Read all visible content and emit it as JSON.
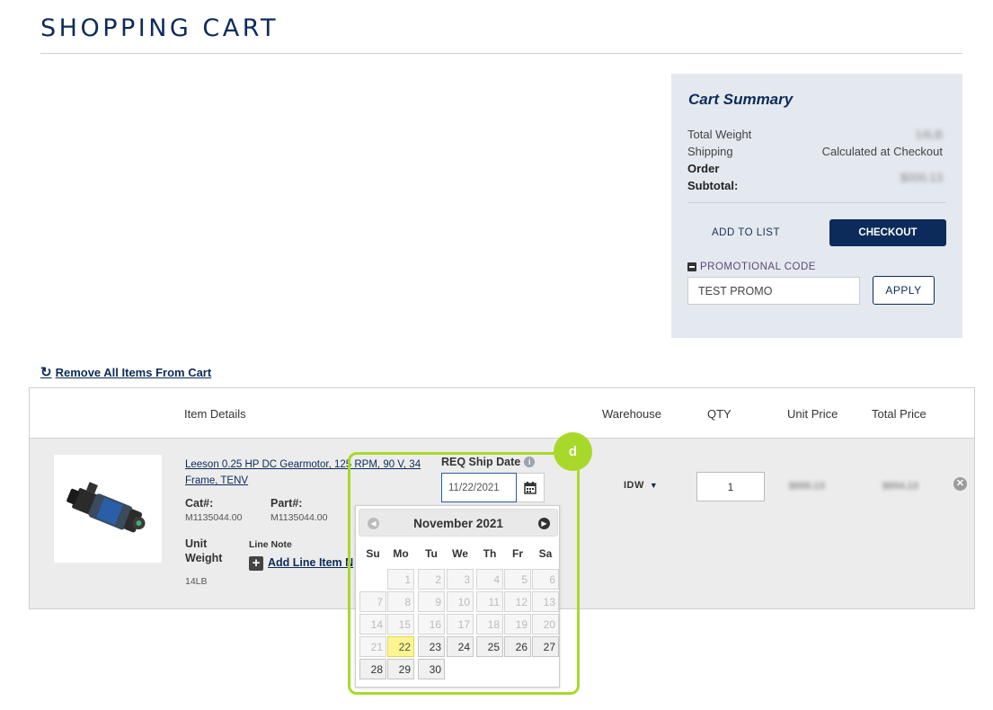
{
  "page": {
    "title": "SHOPPING CART"
  },
  "summary": {
    "title": "Cart Summary",
    "total_weight_label": "Total Weight",
    "total_weight_value": "14LB",
    "shipping_label": "Shipping",
    "shipping_value": "Calculated at Checkout",
    "subtotal_label_line1": "Order",
    "subtotal_label_line2": "Subtotal:",
    "subtotal_value": "$000.13",
    "add_to_list": "ADD TO LIST",
    "checkout": "CHECKOUT",
    "promo_label": "PROMOTIONAL CODE",
    "promo_value": "TEST PROMO",
    "apply": "APPLY"
  },
  "remove_all": "Remove All Items From Cart",
  "table": {
    "headers": {
      "item_details": "Item Details",
      "warehouse": "Warehouse",
      "qty": "QTY",
      "unit_price": "Unit Price",
      "total_price": "Total Price"
    },
    "row": {
      "product_name": "Leeson 0.25 HP DC Gearmotor, 125 RPM, 90 V, 34 Frame, TENV",
      "cat_label": "Cat#:",
      "cat_value": "M1135044.00",
      "part_label": "Part#:",
      "part_value": "M1135044.00",
      "unit_weight_label_line1": "Unit",
      "unit_weight_label_line2": "Weight",
      "unit_weight_value": "14LB",
      "line_note_label": "Line Note",
      "add_line_item_note": "Add Line Item N",
      "req_ship_label": "REQ Ship Date",
      "req_ship_value": "11/22/2021",
      "warehouse": "IDW",
      "qty": "1",
      "unit_price": "$000.13",
      "total_price": "$004.13"
    }
  },
  "datepicker": {
    "month_label": "November 2021",
    "weekdays": [
      "Su",
      "Mo",
      "Tu",
      "We",
      "Th",
      "Fr",
      "Sa"
    ],
    "first_weekday": 1,
    "days_in_month": 30,
    "today": 22,
    "badge": "d",
    "highlight_color": "#a8d92a"
  },
  "colors": {
    "brand": "#0c2b5a",
    "today": "#fdf58f"
  }
}
